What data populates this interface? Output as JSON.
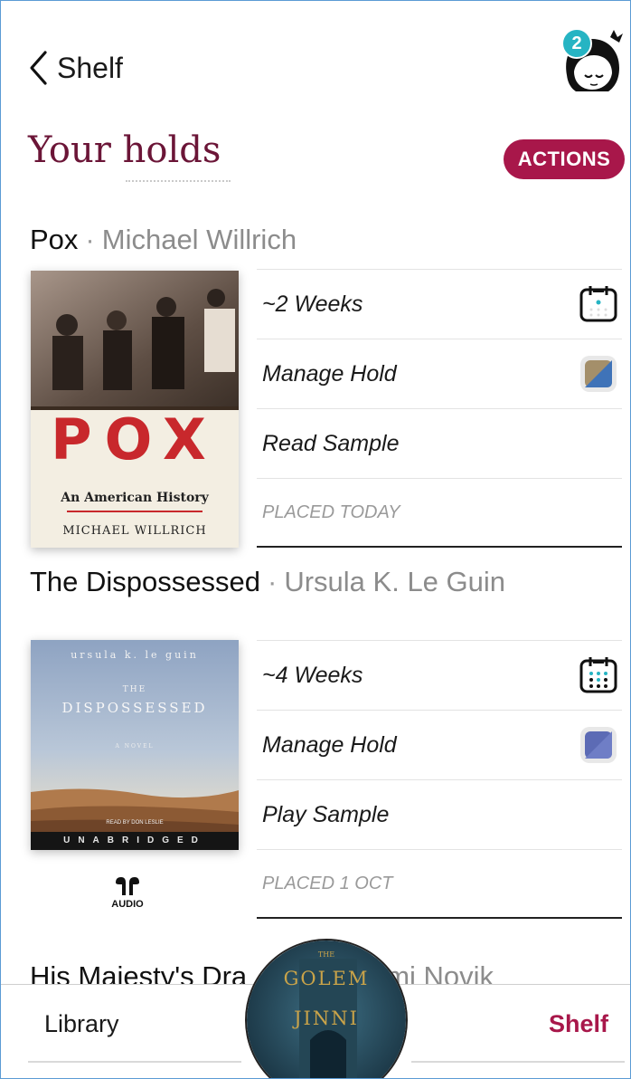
{
  "header": {
    "back_label": "Shelf",
    "notification_count": "2"
  },
  "page": {
    "title": "Your holds",
    "actions_label": "ACTIONS"
  },
  "holds": [
    {
      "title": "Pox",
      "author": "Michael Willrich",
      "cover": {
        "big_title": "POX",
        "subtitle": "An American History",
        "author": "MICHAEL WILLRICH"
      },
      "wait": "~2 Weeks",
      "manage": "Manage Hold",
      "sample": "Read Sample",
      "placed": "PLACED TODAY",
      "swatch": [
        "#a48f6a",
        "#3f73b8"
      ]
    },
    {
      "title": "The Dispossessed",
      "author": "Ursula K. Le Guin",
      "cover": {
        "author_line": "ursula k. le guin",
        "the": "THE",
        "big_title": "DISPOSSESSED",
        "novel": "A NOVEL",
        "reader": "READ BY DON LESLIE",
        "band": "UNABRIDGED"
      },
      "wait": "~4 Weeks",
      "manage": "Manage Hold",
      "sample": "Play Sample",
      "placed": "PLACED 1 OCT",
      "format_label": "AUDIO",
      "swatch": [
        "#5c6bb5",
        "#6f7ec6"
      ]
    }
  ],
  "partial": {
    "title_visible": "His Majesty's Dra",
    "author_visible": "mi Novik"
  },
  "now_playing": {
    "line1": "GOLEM",
    "line2": "JINNI",
    "small": "THE"
  },
  "bottom_nav": {
    "library": "Library",
    "shelf": "Shelf"
  },
  "colors": {
    "accent": "#a8174a",
    "title": "#6b1537",
    "badge": "#26b4c3"
  }
}
